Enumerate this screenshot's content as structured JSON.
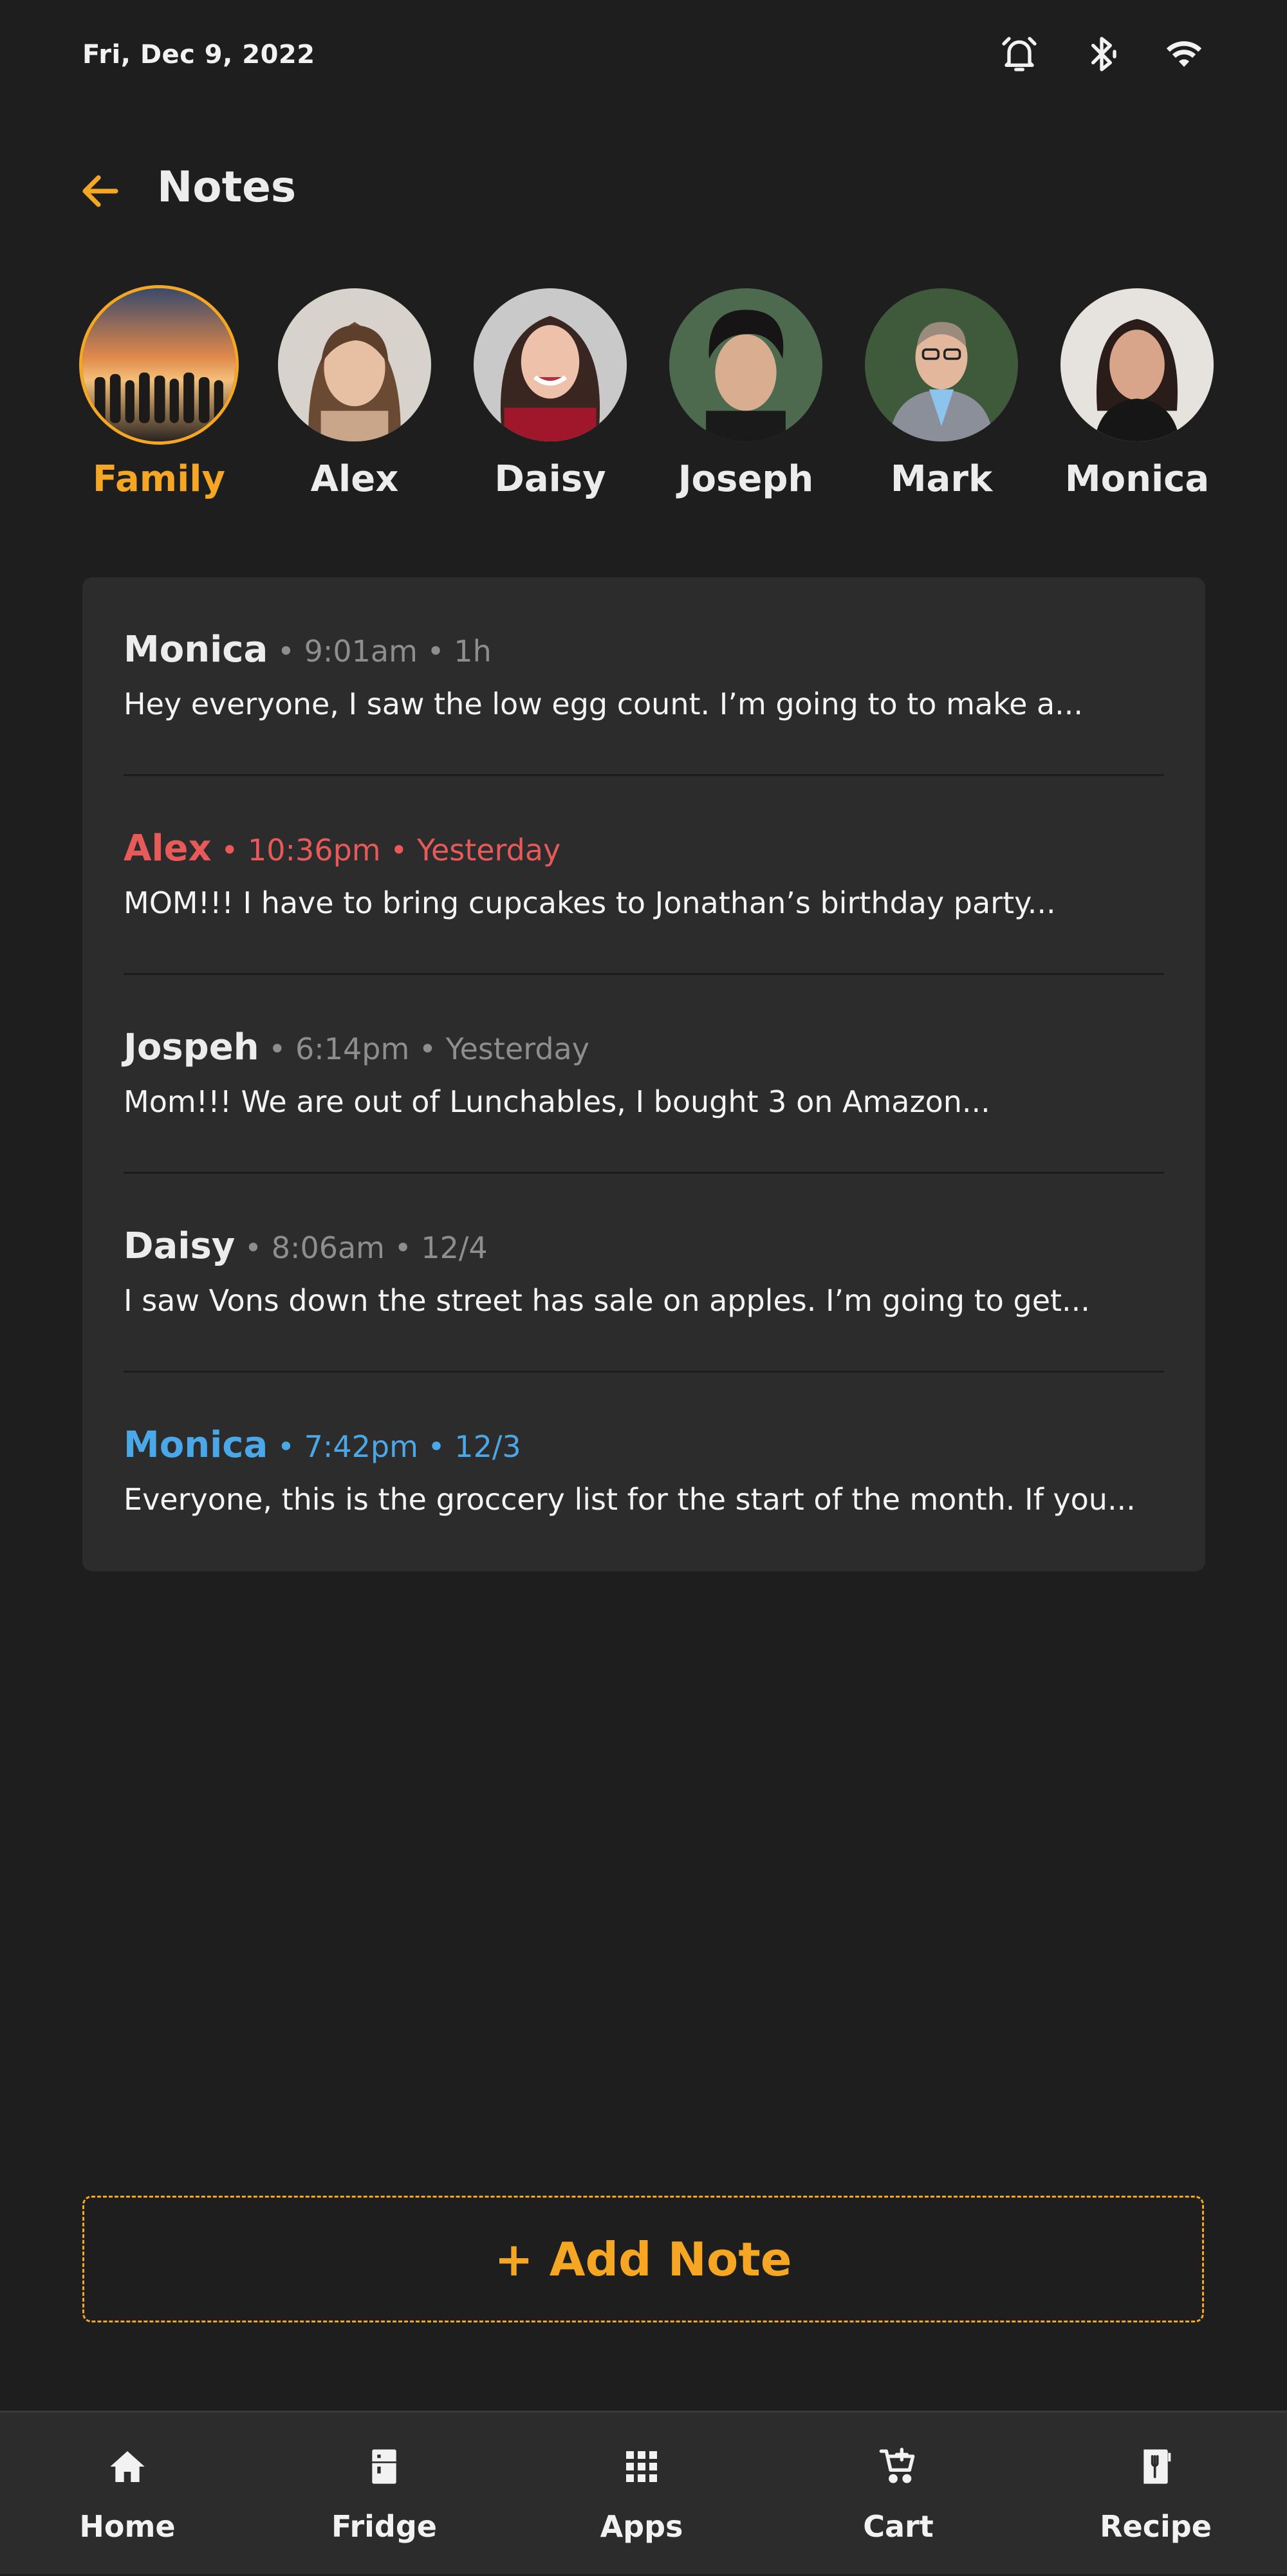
{
  "status_bar": {
    "date": "Fri, Dec 9, 2022",
    "icons": [
      "alarm-icon",
      "bluetooth-icon",
      "wifi-icon"
    ]
  },
  "header": {
    "title": "Notes",
    "back_icon": "arrow-left-icon"
  },
  "colors": {
    "accent": "#f5a623",
    "alex": "#e85a5a",
    "monica_highlight": "#4aa8e8",
    "meta_gray": "#8e8e8e",
    "background": "#1e1e1e",
    "card": "#2c2c2c"
  },
  "members": [
    {
      "label": "Family",
      "selected": true
    },
    {
      "label": "Alex",
      "selected": false
    },
    {
      "label": "Daisy",
      "selected": false
    },
    {
      "label": "Joseph",
      "selected": false
    },
    {
      "label": "Mark",
      "selected": false
    },
    {
      "label": "Monica",
      "selected": false
    }
  ],
  "notes": [
    {
      "author": "Monica",
      "meta": " • 9:01am • 1h",
      "text": "Hey everyone, I saw the low egg count. I’m going to to make a...",
      "color": "default"
    },
    {
      "author": "Alex",
      "meta": " • 10:36pm • Yesterday",
      "text": "MOM!!! I have to bring cupcakes to Jonathan’s birthday party...",
      "color": "red"
    },
    {
      "author": "Jospeh",
      "meta": " • 6:14pm • Yesterday",
      "text": "Mom!!! We are out of Lunchables, I bought 3 on Amazon...",
      "color": "default"
    },
    {
      "author": "Daisy",
      "meta": " • 8:06am • 12/4",
      "text": "I saw Vons down the street has sale on apples. I’m going to get...",
      "color": "default"
    },
    {
      "author": "Monica",
      "meta": " • 7:42pm • 12/3",
      "text": "Everyone, this is the groccery list for the start of the month. If you...",
      "color": "blue"
    }
  ],
  "add_note_label": "+ Add Note",
  "bottom_nav": [
    {
      "label": "Home",
      "icon": "home-icon"
    },
    {
      "label": "Fridge",
      "icon": "fridge-icon"
    },
    {
      "label": "Apps",
      "icon": "apps-grid-icon"
    },
    {
      "label": "Cart",
      "icon": "cart-add-icon"
    },
    {
      "label": "Recipe",
      "icon": "recipe-book-icon"
    }
  ]
}
